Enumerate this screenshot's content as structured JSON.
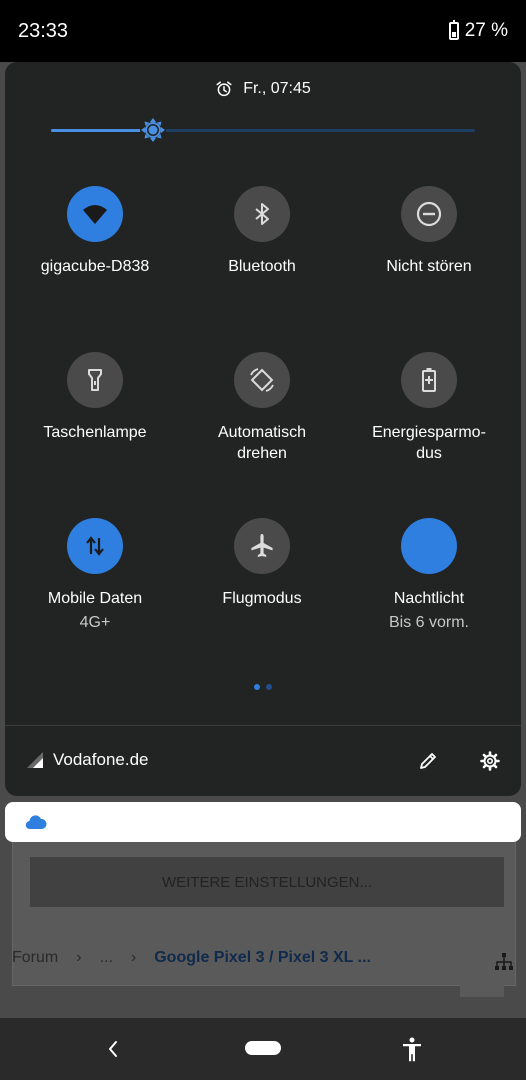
{
  "status_bar": {
    "time": "23:33",
    "battery": "27 %"
  },
  "background_app": {
    "button_label": "WEITERE EINSTELLUNGEN...",
    "breadcrumb": {
      "forum": "Forum",
      "sep1": "›",
      "ellipsis": "...",
      "sep2": "›",
      "current": "Google Pixel 3 / Pixel 3 XL ..."
    }
  },
  "quick_settings": {
    "alarm": "Fr., 07:45",
    "brightness_level": 0.24,
    "tiles": [
      {
        "label": "gigacube-D838",
        "icon": "wifi-icon",
        "on": true
      },
      {
        "label": "Bluetooth",
        "icon": "bluetooth-icon",
        "on": false
      },
      {
        "label": "Nicht stören",
        "icon": "do-not-disturb-icon",
        "on": false
      },
      {
        "label": "Taschenlampe",
        "icon": "flashlight-icon",
        "on": false
      },
      {
        "label": "Automatisch\ndrehen",
        "icon": "auto-rotate-icon",
        "on": false
      },
      {
        "label": "Energiesparmo-\ndus",
        "icon": "battery-saver-icon",
        "on": false
      },
      {
        "label": "Mobile Daten",
        "sub": "4G+",
        "icon": "mobile-data-icon",
        "on": true
      },
      {
        "label": "Flugmodus",
        "icon": "airplane-icon",
        "on": false
      },
      {
        "label": "Nachtlicht",
        "sub": "Bis 6 vorm.",
        "icon": "night-light-icon",
        "on": true
      }
    ],
    "carrier": "Vodafone.de"
  },
  "colors": {
    "accent": "#2e7fe0",
    "panel": "#222323",
    "tile_off": "#4a4a4a"
  }
}
